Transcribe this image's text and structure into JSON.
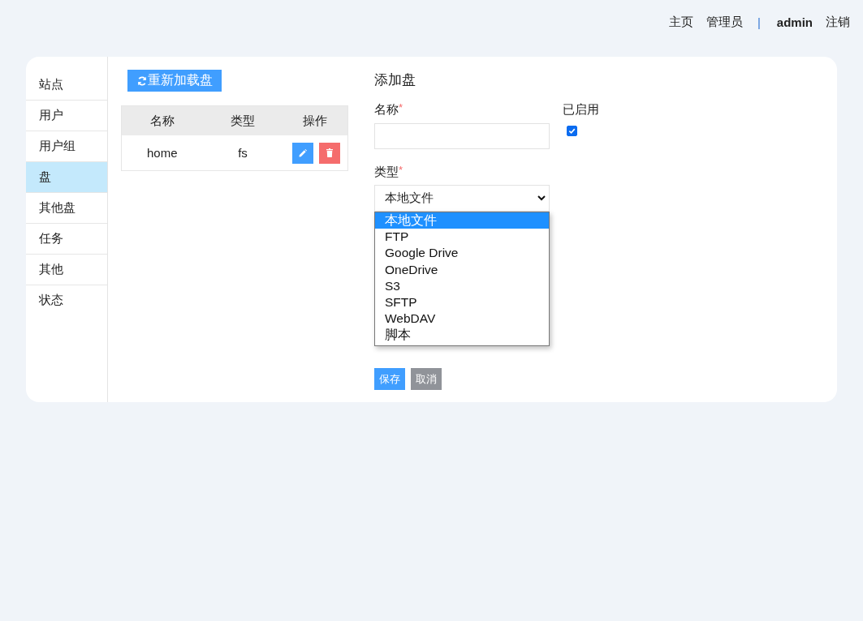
{
  "top_nav": {
    "links": [
      {
        "label": "主页"
      },
      {
        "label": "管理员"
      }
    ],
    "separator": "|",
    "user": "admin",
    "logout": "注销"
  },
  "sidebar": {
    "items": [
      {
        "label": "站点",
        "selected": false
      },
      {
        "label": "用户",
        "selected": false
      },
      {
        "label": "用户组",
        "selected": false
      },
      {
        "label": "盘",
        "selected": true
      },
      {
        "label": "其他盘",
        "selected": false
      },
      {
        "label": "任务",
        "selected": false
      },
      {
        "label": "其他",
        "selected": false
      },
      {
        "label": "状态",
        "selected": false
      }
    ]
  },
  "disks": {
    "reload_button": "重新加载盘",
    "table": {
      "columns": [
        "名称",
        "类型",
        "操作"
      ],
      "rows": [
        {
          "name": "home",
          "type": "fs"
        }
      ]
    }
  },
  "form": {
    "title": "添加盘",
    "name_field": {
      "label": "名称",
      "required_mark": "*"
    },
    "enabled_field": {
      "label": "已启用",
      "checked": true
    },
    "type_field": {
      "label": "类型",
      "required_mark": "*",
      "value": "本地文件",
      "expanded": true,
      "options": [
        {
          "label": "本地文件",
          "selected": true
        },
        {
          "label": "FTP",
          "selected": false
        },
        {
          "label": "Google Drive",
          "selected": false
        },
        {
          "label": "OneDrive",
          "selected": false
        },
        {
          "label": "S3",
          "selected": false
        },
        {
          "label": "SFTP",
          "selected": false
        },
        {
          "label": "WebDAV",
          "selected": false
        },
        {
          "label": "脚本",
          "selected": false
        }
      ]
    },
    "actions": [
      {
        "label": "保存",
        "kind": "primary"
      },
      {
        "label": "取消",
        "kind": "secondary"
      }
    ]
  }
}
